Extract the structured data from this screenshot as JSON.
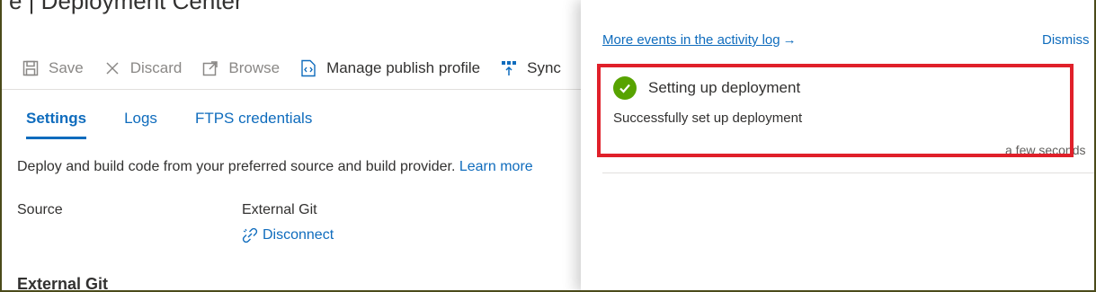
{
  "page": {
    "title": "e | Deployment Center"
  },
  "toolbar": {
    "save": "Save",
    "discard": "Discard",
    "browse": "Browse",
    "manage_publish_profile": "Manage publish profile",
    "sync": "Sync"
  },
  "tabs": [
    {
      "label": "Settings",
      "active": true
    },
    {
      "label": "Logs",
      "active": false
    },
    {
      "label": "FTPS credentials",
      "active": false
    }
  ],
  "settings": {
    "description": "Deploy and build code from your preferred source and build provider.",
    "learn_more": "Learn more",
    "source_label": "Source",
    "source_value": "External Git",
    "disconnect": "Disconnect",
    "section_title": "External Git"
  },
  "notifications": {
    "more_events": "More events in the activity log",
    "more_events_arrow": "→",
    "dismiss": "Dismiss",
    "item": {
      "title": "Setting up deployment",
      "message": "Successfully set up deployment",
      "time": "a few seconds",
      "status": "success",
      "status_color": "#57a300"
    }
  },
  "colors": {
    "link": "#0f6cbd",
    "highlight": "#e0202a",
    "disabled": "#8a8886"
  },
  "icons": {
    "save": "save-icon",
    "discard": "close-icon",
    "browse": "external-link-icon",
    "manage": "code-file-icon",
    "sync": "sync-icon",
    "disconnect": "link-break-icon",
    "success": "checkmark-circle-icon"
  }
}
